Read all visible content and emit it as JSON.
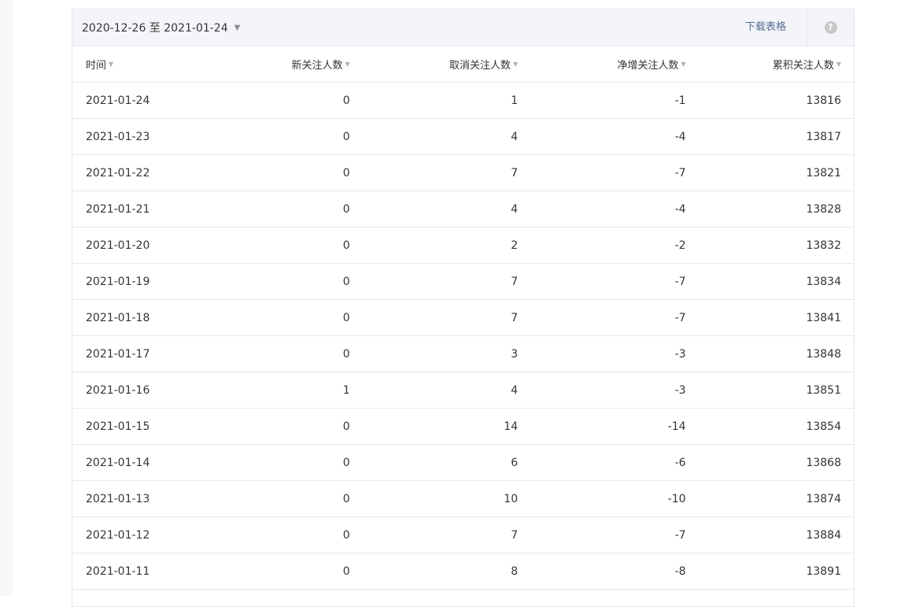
{
  "toolbar": {
    "date_range": "2020-12-26 至 2021-01-24",
    "date_caret": "▼",
    "download_label": "下载表格",
    "help_glyph": "?"
  },
  "table": {
    "columns": [
      "时间",
      "新关注人数",
      "取消关注人数",
      "净增关注人数",
      "累积关注人数"
    ],
    "sort_glyph": "▼",
    "rows": [
      [
        "2021-01-24",
        "0",
        "1",
        "-1",
        "13816"
      ],
      [
        "2021-01-23",
        "0",
        "4",
        "-4",
        "13817"
      ],
      [
        "2021-01-22",
        "0",
        "7",
        "-7",
        "13821"
      ],
      [
        "2021-01-21",
        "0",
        "4",
        "-4",
        "13828"
      ],
      [
        "2021-01-20",
        "0",
        "2",
        "-2",
        "13832"
      ],
      [
        "2021-01-19",
        "0",
        "7",
        "-7",
        "13834"
      ],
      [
        "2021-01-18",
        "0",
        "7",
        "-7",
        "13841"
      ],
      [
        "2021-01-17",
        "0",
        "3",
        "-3",
        "13848"
      ],
      [
        "2021-01-16",
        "1",
        "4",
        "-3",
        "13851"
      ],
      [
        "2021-01-15",
        "0",
        "14",
        "-14",
        "13854"
      ],
      [
        "2021-01-14",
        "0",
        "6",
        "-6",
        "13868"
      ],
      [
        "2021-01-13",
        "0",
        "10",
        "-10",
        "13874"
      ],
      [
        "2021-01-12",
        "0",
        "7",
        "-7",
        "13884"
      ],
      [
        "2021-01-11",
        "0",
        "8",
        "-8",
        "13891"
      ]
    ]
  },
  "colors": {
    "link": "#576b95",
    "toolbar_bg": "#f4f5f9",
    "border": "#e7e7eb",
    "text": "#353535"
  }
}
